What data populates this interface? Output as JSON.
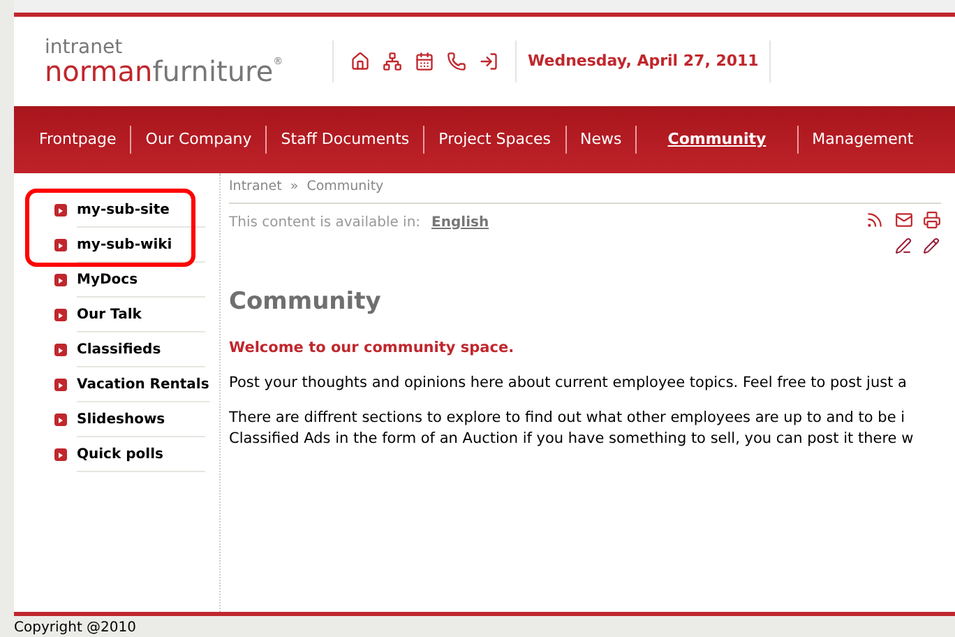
{
  "logo": {
    "top": "intranet",
    "brand_red": "norman",
    "brand_gray": "furniture",
    "mark": "®"
  },
  "header": {
    "date": "Wednesday, April 27, 2011"
  },
  "nav": [
    {
      "label": "Frontpage",
      "selected": false
    },
    {
      "label": "Our Company",
      "selected": false
    },
    {
      "label": "Staff Documents",
      "selected": false
    },
    {
      "label": "Project Spaces",
      "selected": false
    },
    {
      "label": "News",
      "selected": false
    },
    {
      "label": "Community",
      "selected": true
    },
    {
      "label": "Management",
      "selected": false
    }
  ],
  "sidebar": {
    "items": [
      {
        "label": "my-sub-site",
        "highlighted": true
      },
      {
        "label": "my-sub-wiki",
        "highlighted": true
      },
      {
        "label": "MyDocs",
        "highlighted": false
      },
      {
        "label": "Our Talk",
        "highlighted": false
      },
      {
        "label": "Classifieds",
        "highlighted": false
      },
      {
        "label": "Vacation Rentals",
        "highlighted": false
      },
      {
        "label": "Slideshows",
        "highlighted": false
      },
      {
        "label": "Quick polls",
        "highlighted": false
      }
    ]
  },
  "breadcrumb": [
    "Intranet",
    "»",
    "Community"
  ],
  "languages": {
    "label": "This content is available in:",
    "link": "English"
  },
  "content": {
    "title": "Community",
    "intro": "Welcome to our community space.",
    "paragraphs": [
      [
        "Post your thoughts and opinions here about current employee topics. Feel free to post just a"
      ],
      [
        "There are diffrent sections to explore to find out what other employees are up to and to be i",
        "Classified Ads in the form of an Auction if you have something to sell, you can post it there w"
      ]
    ]
  },
  "footer": {
    "copyright": "Copyright @2010"
  }
}
